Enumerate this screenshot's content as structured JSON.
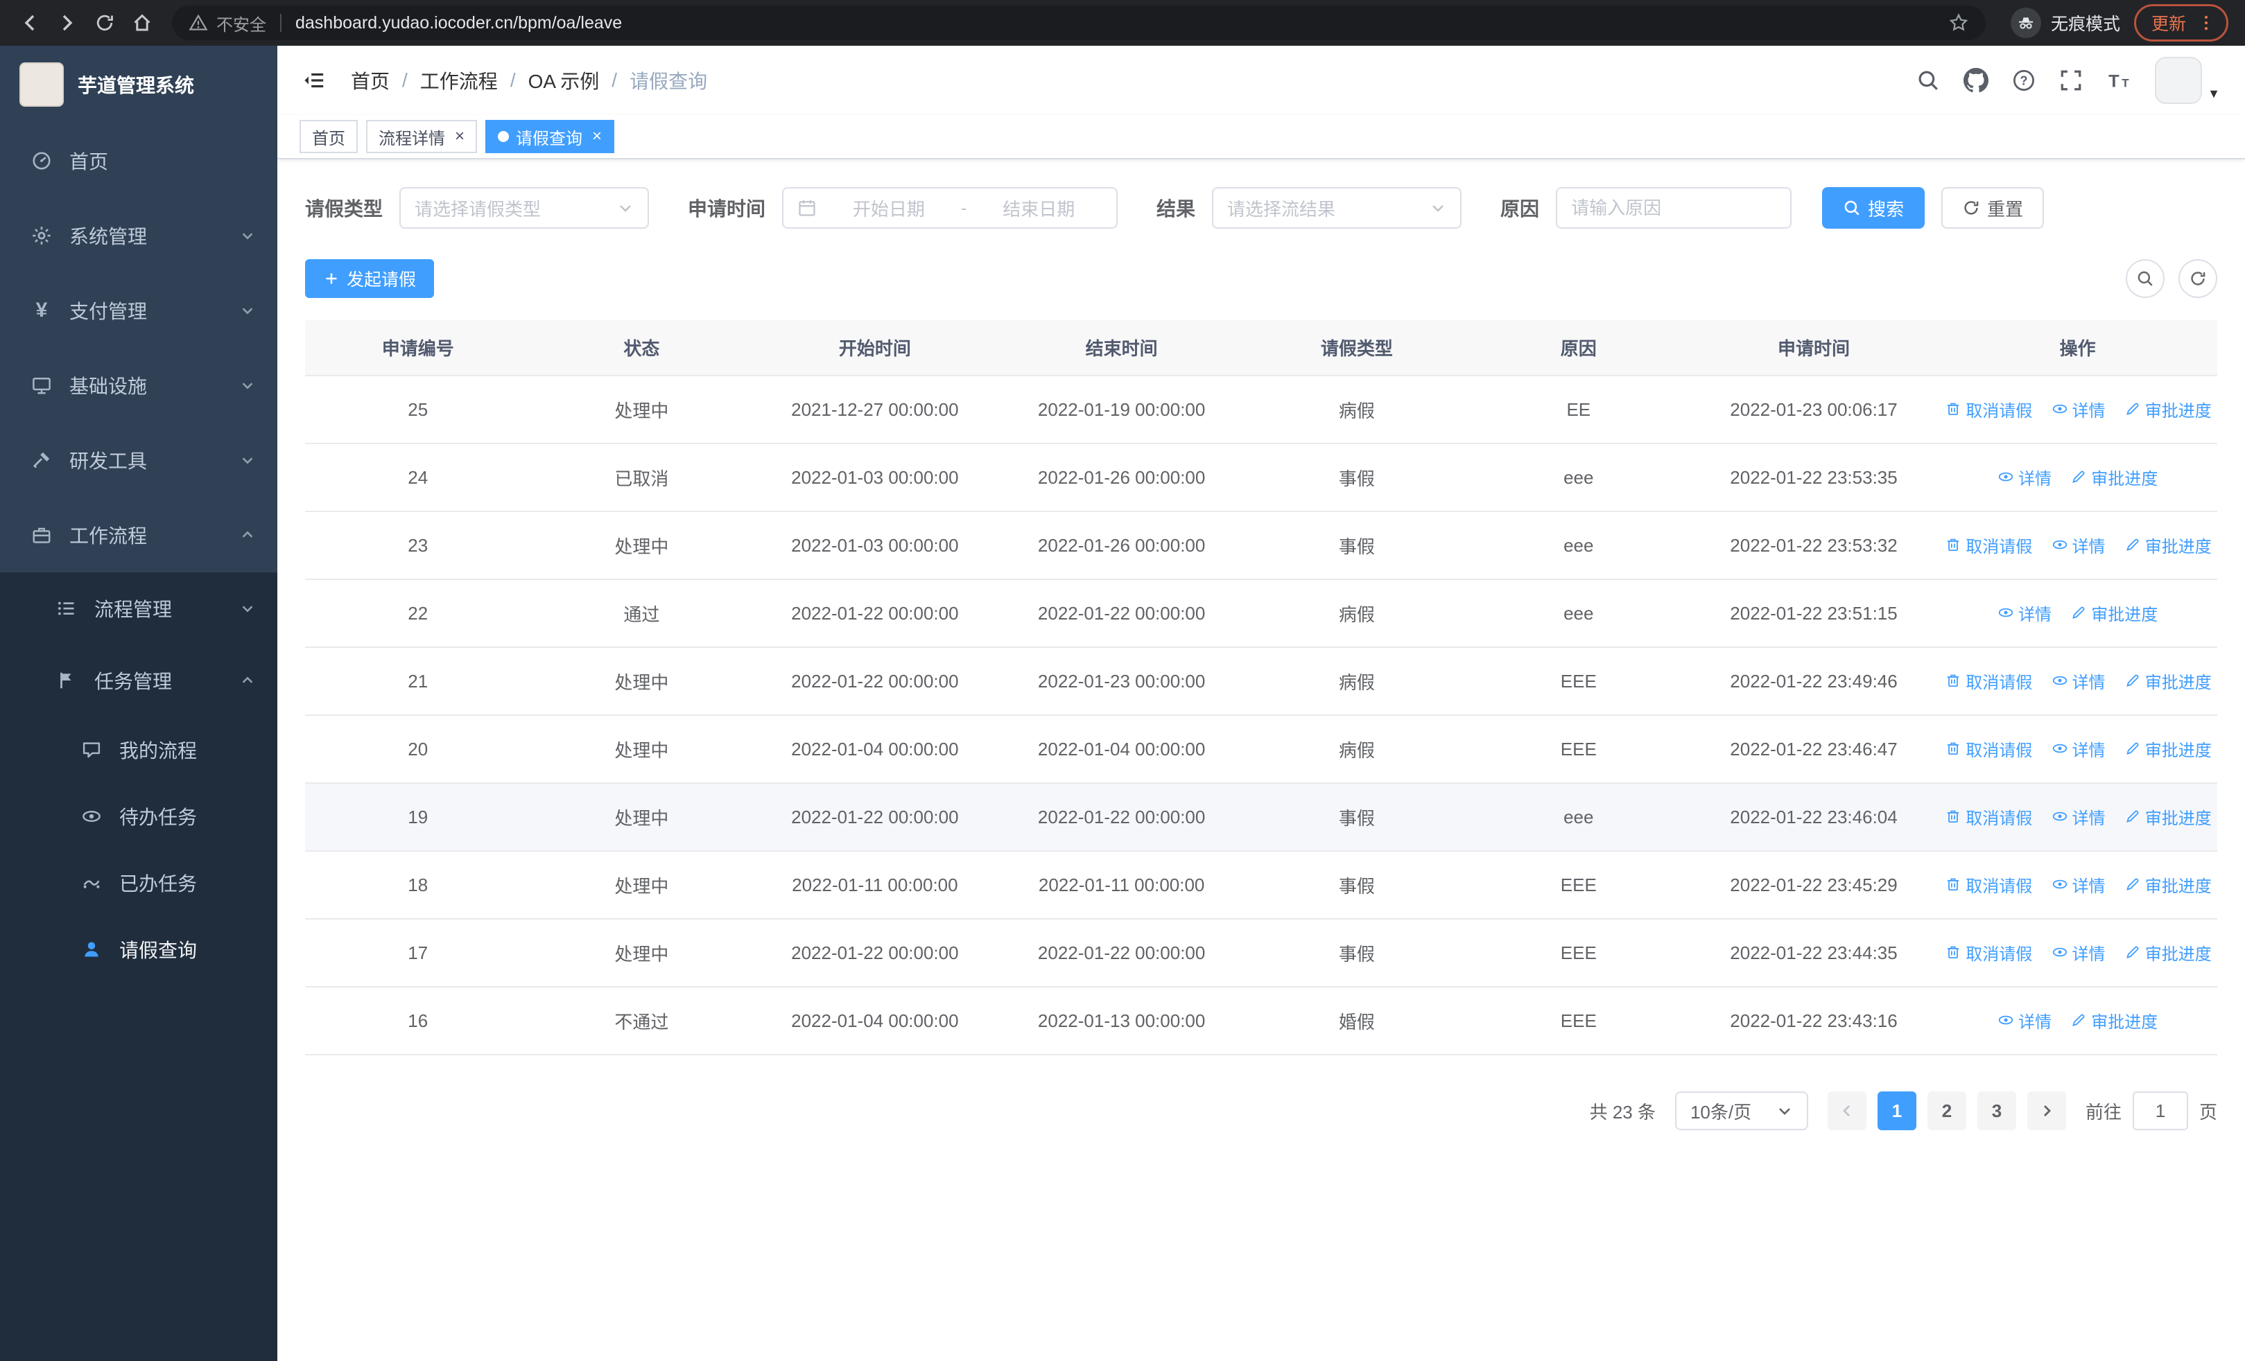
{
  "theme": {
    "accent": "#409eff",
    "sidebar_bg": "#1f2d3d",
    "sidebar_top_bg": "#304156",
    "chrome_bg": "#232427",
    "update_badge_color": "#e8734d",
    "table_header_bg": "#f8f8f9"
  },
  "browser": {
    "security_warning": "不安全",
    "url": "dashboard.yudao.iocoder.cn/bpm/oa/leave",
    "incognito_label": "无痕模式",
    "update_label": "更新"
  },
  "sidebar": {
    "logo_title": "芋道管理系统",
    "items": {
      "home": "首页",
      "system": "系统管理",
      "payment": "支付管理",
      "infra": "基础设施",
      "devtools": "研发工具",
      "workflow": "工作流程",
      "process_mgmt": "流程管理",
      "task_mgmt": "任务管理",
      "my_process": "我的流程",
      "todo": "待办任务",
      "done": "已办任务",
      "leave_query": "请假查询"
    }
  },
  "header": {
    "breadcrumb": [
      "首页",
      "工作流程",
      "OA 示例",
      "请假查询"
    ]
  },
  "tabs": [
    {
      "label": "首页",
      "active": false,
      "closable": false
    },
    {
      "label": "流程详情",
      "active": false,
      "closable": true
    },
    {
      "label": "请假查询",
      "active": true,
      "closable": true
    }
  ],
  "filters": {
    "leave_type_label": "请假类型",
    "leave_type_placeholder": "请选择请假类型",
    "apply_time_label": "申请时间",
    "start_date_placeholder": "开始日期",
    "range_separator": "-",
    "end_date_placeholder": "结束日期",
    "result_label": "结果",
    "result_placeholder": "请选择流结果",
    "reason_label": "原因",
    "reason_placeholder": "请输入原因",
    "search_label": "搜索",
    "reset_label": "重置"
  },
  "toolbar": {
    "create_label": "发起请假"
  },
  "table": {
    "headers": [
      "申请编号",
      "状态",
      "开始时间",
      "结束时间",
      "请假类型",
      "原因",
      "申请时间",
      "操作"
    ],
    "actions": {
      "cancel": "取消请假",
      "detail": "详情",
      "progress": "审批进度"
    },
    "rows": [
      {
        "id": "25",
        "status": "处理中",
        "start": "2021-12-27 00:00:00",
        "end": "2022-01-19 00:00:00",
        "type": "病假",
        "reason": "EE",
        "apply_time": "2022-01-23 00:06:17",
        "cancelable": true,
        "highlighted": false
      },
      {
        "id": "24",
        "status": "已取消",
        "start": "2022-01-03 00:00:00",
        "end": "2022-01-26 00:00:00",
        "type": "事假",
        "reason": "eee",
        "apply_time": "2022-01-22 23:53:35",
        "cancelable": false,
        "highlighted": false
      },
      {
        "id": "23",
        "status": "处理中",
        "start": "2022-01-03 00:00:00",
        "end": "2022-01-26 00:00:00",
        "type": "事假",
        "reason": "eee",
        "apply_time": "2022-01-22 23:53:32",
        "cancelable": true,
        "highlighted": false
      },
      {
        "id": "22",
        "status": "通过",
        "start": "2022-01-22 00:00:00",
        "end": "2022-01-22 00:00:00",
        "type": "病假",
        "reason": "eee",
        "apply_time": "2022-01-22 23:51:15",
        "cancelable": false,
        "highlighted": false
      },
      {
        "id": "21",
        "status": "处理中",
        "start": "2022-01-22 00:00:00",
        "end": "2022-01-23 00:00:00",
        "type": "病假",
        "reason": "EEE",
        "apply_time": "2022-01-22 23:49:46",
        "cancelable": true,
        "highlighted": false
      },
      {
        "id": "20",
        "status": "处理中",
        "start": "2022-01-04 00:00:00",
        "end": "2022-01-04 00:00:00",
        "type": "病假",
        "reason": "EEE",
        "apply_time": "2022-01-22 23:46:47",
        "cancelable": true,
        "highlighted": false
      },
      {
        "id": "19",
        "status": "处理中",
        "start": "2022-01-22 00:00:00",
        "end": "2022-01-22 00:00:00",
        "type": "事假",
        "reason": "eee",
        "apply_time": "2022-01-22 23:46:04",
        "cancelable": true,
        "highlighted": true
      },
      {
        "id": "18",
        "status": "处理中",
        "start": "2022-01-11 00:00:00",
        "end": "2022-01-11 00:00:00",
        "type": "事假",
        "reason": "EEE",
        "apply_time": "2022-01-22 23:45:29",
        "cancelable": true,
        "highlighted": false
      },
      {
        "id": "17",
        "status": "处理中",
        "start": "2022-01-22 00:00:00",
        "end": "2022-01-22 00:00:00",
        "type": "事假",
        "reason": "EEE",
        "apply_time": "2022-01-22 23:44:35",
        "cancelable": true,
        "highlighted": false
      },
      {
        "id": "16",
        "status": "不通过",
        "start": "2022-01-04 00:00:00",
        "end": "2022-01-13 00:00:00",
        "type": "婚假",
        "reason": "EEE",
        "apply_time": "2022-01-22 23:43:16",
        "cancelable": false,
        "highlighted": false
      }
    ]
  },
  "pagination": {
    "total": "共 23 条",
    "page_size": "10条/页",
    "pages": [
      "1",
      "2",
      "3"
    ],
    "active_page": "1",
    "goto_label": "前往",
    "goto_value": "1",
    "goto_suffix": "页"
  }
}
